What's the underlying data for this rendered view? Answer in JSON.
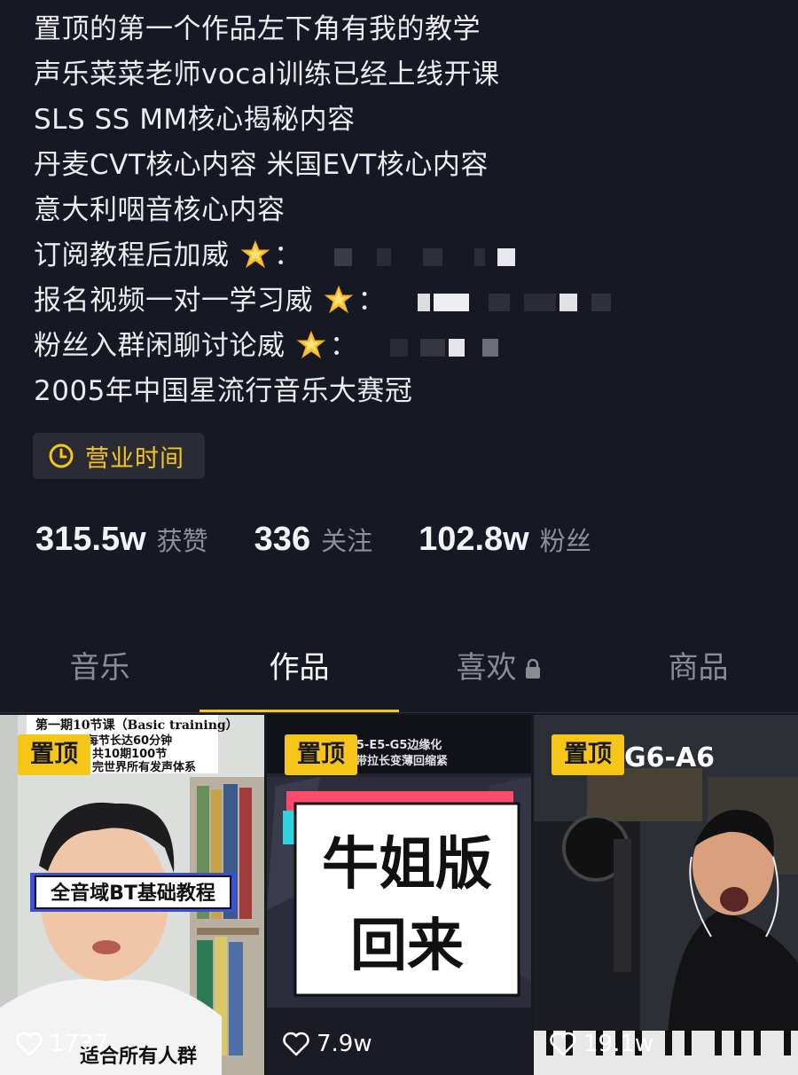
{
  "bio": {
    "lines": [
      "置顶的第一个作品左下角有我的教学",
      "声乐菜菜老师vocal训练已经上线开课",
      "SLS SS MM核心揭秘内容",
      "丹麦CVT核心内容 米国EVT核心内容",
      "意大利咽音核心内容",
      "订阅教程后加威",
      "报名视频一对一学习威",
      "粉丝入群闲聊讨论威",
      "2005年中国星流行音乐大赛冠"
    ],
    "colon": "："
  },
  "business_hours": {
    "label": "营业时间",
    "icon": "clock-icon"
  },
  "stats": {
    "likes": {
      "value": "315.5w",
      "label": "获赞"
    },
    "following": {
      "value": "336",
      "label": "关注"
    },
    "followers": {
      "value": "102.8w",
      "label": "粉丝"
    }
  },
  "tabs": [
    {
      "label": "音乐",
      "active": false
    },
    {
      "label": "作品",
      "active": true
    },
    {
      "label": "喜欢",
      "active": false,
      "locked": true
    },
    {
      "label": "商品",
      "active": false
    }
  ],
  "videos": [
    {
      "pinned_label": "置顶",
      "likes": "1737",
      "overlay_top": [
        "第一期10节课（Basic training）",
        "每节长达60分钟",
        "共10期100节",
        "完世界所有发声体系"
      ],
      "overlay_banner": "全音域BT基础教程",
      "overlay_bottom": "适合所有人群"
    },
    {
      "pinned_label": "置顶",
      "likes": "7.9w",
      "overlay_top": [
        "E5-E5-G5边缘化",
        "带拉长变薄回缩紧"
      ],
      "overlay_card": [
        "牛姐版",
        "回来"
      ]
    },
    {
      "pinned_label": "置顶",
      "likes": "19.1w",
      "overlay_top": [
        "G6-A6"
      ]
    }
  ],
  "colors": {
    "background": "#161823",
    "accent": "#f5c517",
    "muted": "#8e8f97"
  }
}
